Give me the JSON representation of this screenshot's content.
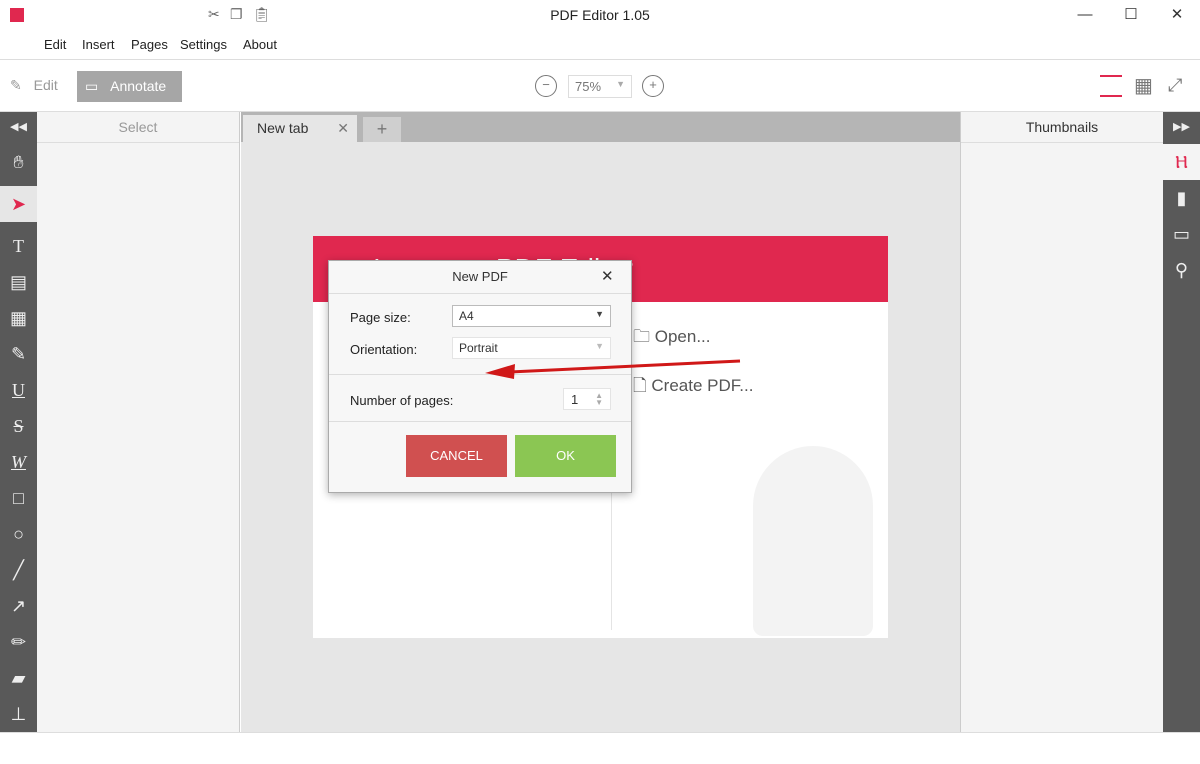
{
  "window": {
    "title": "PDF Editor 1.05",
    "minimize": "—",
    "maximize": "☐",
    "close": "✕"
  },
  "menu": [
    "Edit",
    "Insert",
    "Pages",
    "Settings",
    "About"
  ],
  "toolbar": {
    "edit": "Edit",
    "annotate": "Annotate",
    "zoom": "75%"
  },
  "left_panel": {
    "title": "Select"
  },
  "right_panel": {
    "title": "Thumbnails"
  },
  "tabs": [
    {
      "label": "New tab"
    }
  ],
  "start_page": {
    "title": "Icecream PDF Editor",
    "open": "Open...",
    "create": "Create PDF..."
  },
  "dialog": {
    "title": "New PDF",
    "page_size_label": "Page size:",
    "page_size": "A4",
    "orientation_label": "Orientation:",
    "orientation": "Portrait",
    "pages_label": "Number of pages:",
    "pages": "1",
    "cancel": "CANCEL",
    "ok": "OK"
  },
  "colors": {
    "accent": "#e0284f",
    "cancel": "#d05050",
    "ok": "#8bc653",
    "sidebar": "#595959"
  }
}
